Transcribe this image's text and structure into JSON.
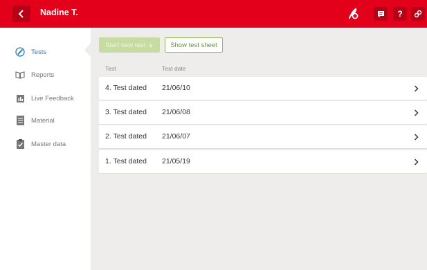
{
  "header": {
    "user_name": "Nadine T.",
    "colors": {
      "bar": "#e3001b",
      "button": "#b80016"
    },
    "icons": [
      "chevron-left-icon",
      "clef-icon",
      "chat-icon",
      "help-icon",
      "link-icon"
    ],
    "help_label": "?"
  },
  "sidebar": {
    "items": [
      {
        "label": "Tests",
        "icon": "pencil-circle-icon",
        "active": true
      },
      {
        "label": "Reports",
        "icon": "open-book-icon",
        "active": false
      },
      {
        "label": "Live Feedback",
        "icon": "bar-chart-icon",
        "active": false
      },
      {
        "label": "Material",
        "icon": "document-icon",
        "active": false
      },
      {
        "label": "Master data",
        "icon": "clipboard-check-icon",
        "active": false
      }
    ],
    "active_color": "#2a7fb0"
  },
  "toolbar": {
    "start_label": "Start new test",
    "start_plus": "+",
    "sheet_label": "Show test sheet"
  },
  "table": {
    "columns": [
      "Test",
      "Test date"
    ],
    "rows": [
      {
        "test": "4.  Test dated",
        "date": "21/06/10"
      },
      {
        "test": "3.  Test dated",
        "date": "21/06/08"
      },
      {
        "test": "2.  Test dated",
        "date": "21/06/07"
      },
      {
        "test": "1.  Test dated",
        "date": "21/05/19"
      }
    ]
  }
}
